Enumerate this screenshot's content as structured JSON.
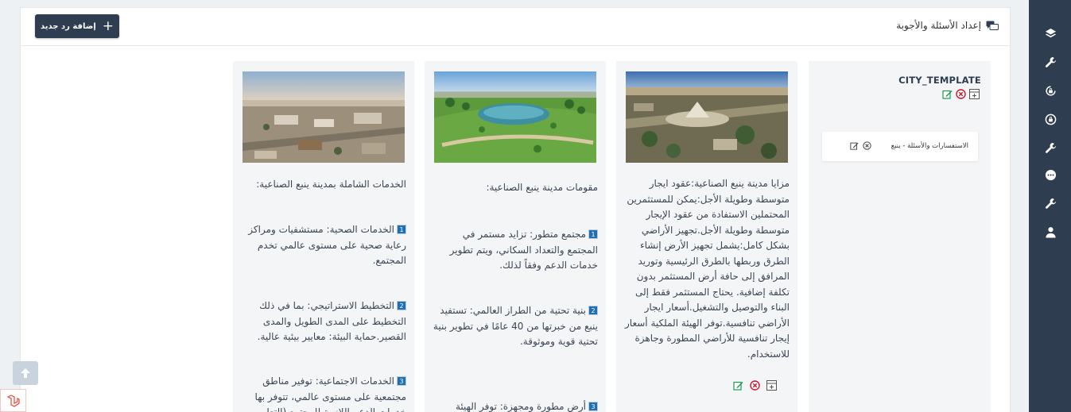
{
  "header": {
    "title": "إعداد الأسئلة والأجوبة",
    "add_button_label": "إضافة رد جديد",
    "add_button_icon": "plus-icon"
  },
  "sidebar": {
    "items": [
      {
        "icon": "layers-icon"
      },
      {
        "icon": "wrench-icon"
      },
      {
        "icon": "lock-refresh-icon"
      },
      {
        "icon": "lock-icon"
      },
      {
        "icon": "wrench-icon"
      },
      {
        "icon": "chat-bubble-icon"
      },
      {
        "icon": "wrench-icon"
      },
      {
        "icon": "user-icon"
      }
    ]
  },
  "template": {
    "title": "CITY_TEMPLATE",
    "box_label": "الاستفسارات والأسئلة - ينبع"
  },
  "card_a": {
    "text": "مزايا مدينة ينبع الصناعية:عقود ايجار متوسطة وطويلة الأجل:يمكن للمستثمرين المحتملين الاستفادة من عقود الإيجار متوسطة وطويلة الأجل.تجهيز الأراضي بشكل كامل:يشمل تجهيز الأرض إنشاء الطرق وربطها بالطرق الرئيسية وتوريد المرافق إلى حافة أرض المستثمر بدون تكلفة إضافية. يحتاج المستثمر فقط إلى البناء والتوصيل والتشغيل.أسعار ايجار الأراضي تنافسية.توفر الهيئة الملكية أسعار إيجار تنافسية للأراضي المطورة وجاهزة للاستخدام."
  },
  "card_b": {
    "intro": "مقومات مدينة ينبع الصناعية:",
    "items": [
      {
        "num": "1",
        "text": "مجتمع متطور: تزايد مستمر في المجتمع والتعداد السكاني، ويتم تطوير خدمات الدعم وفقاً لذلك."
      },
      {
        "num": "2",
        "text": "بنية تحتية من الطراز العالمي: تستفيد ينبع من خبرتها من 40 عامًا في تطوير بنية تحتية قوية وموثوقة."
      },
      {
        "num": "3",
        "text": "أرض مطورة ومجهزة: توفر الهيئة"
      }
    ]
  },
  "card_c": {
    "intro": "الخدمات الشاملة بمدينة ينبع الصناعية:",
    "items": [
      {
        "num": "1",
        "text": "الخدمات الصحية: مستشفيات ومراكز رعاية صحية على مستوى عالمي تخدم المجتمع."
      },
      {
        "num": "2",
        "text": "التخطيط الاستراتيجي: بما في ذلك التخطيط على المدى الطويل والمدى القصير.حماية البيئة: معايير بيئية عالية."
      },
      {
        "num": "3",
        "text": "الخدمات الاجتماعية: توفير مناطق مجتمعية على مستوى عالمي، تتوفر بها خدمات الدعم اللازمة للمجتمع (التعليم"
      }
    ]
  },
  "colors": {
    "sidebar": "#2e3e50",
    "button": "#2e3e50",
    "text": "#3b4654",
    "number_badge": "#1f6fb2",
    "edit_icon": "#1a9b4b",
    "delete_icon": "#d0142c"
  }
}
